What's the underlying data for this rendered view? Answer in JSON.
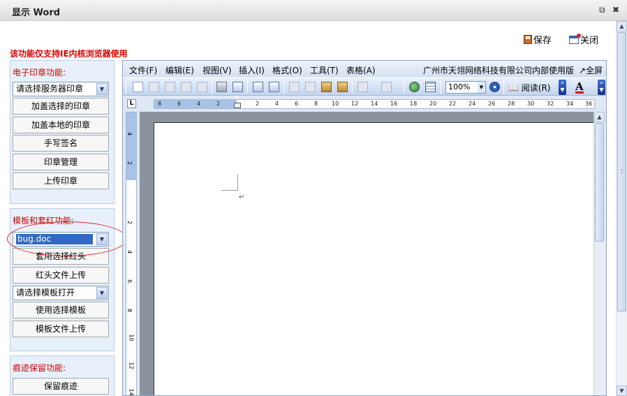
{
  "window": {
    "title": "显示 Word",
    "restore_icon": "⧉",
    "close_icon": "✖"
  },
  "actions": {
    "save_label": "保存",
    "close_label": "关闭"
  },
  "notice": "该功能仅支持IE内核浏览器使用",
  "seal_panel": {
    "title": "电子印章功能:",
    "select_value": "请选择服务器印章",
    "buttons": [
      "加盖选择的印章",
      "加盖本地的印章",
      "手写签名",
      "印章管理",
      "上传印章"
    ]
  },
  "template_panel": {
    "title": "模板和套红功能:",
    "redhead_select_value": "bug.doc",
    "apply_redhead_label": "套用选择红头",
    "upload_redhead_label": "红头文件上传",
    "template_select_value": "请选择模板打开",
    "use_template_label": "使用选择模板",
    "upload_template_label": "模板文件上传"
  },
  "trace_panel": {
    "title": "痕迹保留功能:",
    "keep_trace_label": "保留痕迹"
  },
  "word": {
    "menus": [
      "文件(F)",
      "编辑(E)",
      "视图(V)",
      "插入(I)",
      "格式(O)",
      "工具(T)",
      "表格(A)"
    ],
    "license_text": "广州市天翎网络科技有限公司内部使用版",
    "fullscreen_label": "↗全屏",
    "zoom_value": "100%",
    "read_label": "阅读(R)",
    "font_color_label": "A",
    "ruler_corner": "L",
    "hruler_ticks": [
      "8",
      "6",
      "4",
      "2",
      "2",
      "4",
      "6",
      "8",
      "10",
      "12",
      "14",
      "16",
      "18",
      "20",
      "22",
      "24",
      "26",
      "28",
      "30",
      "32",
      "34",
      "36"
    ],
    "vruler_ticks": [
      "4",
      "2",
      "2",
      "4",
      "6",
      "8",
      "10",
      "12",
      "14"
    ],
    "paragraph_mark": "↵"
  }
}
